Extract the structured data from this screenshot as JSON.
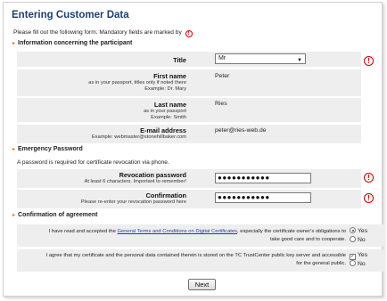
{
  "page": {
    "title": "Entering Customer Data",
    "intro": "Please fill out the following form. Mandatory fields are marked by",
    "required_icon": "!"
  },
  "sections": {
    "participant": "Information concerning the participant",
    "emergency": "Emergency Password",
    "confirmation": "Confirmation of agreement"
  },
  "participant": {
    "title_label": "Title",
    "title_value": "Mr",
    "first_name_label": "First name",
    "first_name_sub1": "as in your passport, titles only if noted there",
    "first_name_sub2": "Example: Dr. Mary",
    "first_name_value": "Peter",
    "last_name_label": "Last name",
    "last_name_sub1": "as in your passport",
    "last_name_sub2": "Example: Smith",
    "last_name_value": "Ries",
    "email_label": "E-mail address",
    "email_sub": "Example: webmaster@stonehillbaker.com",
    "email_value": "peter@ries-web.de"
  },
  "emergency": {
    "note": "A password is required for certificate revocation via phone.",
    "revocation_label": "Revocation password",
    "revocation_sub": "At least 6 characters. Important to remember!",
    "revocation_value": "●●●●●●●●●●●",
    "confirmation_label": "Confirmation",
    "confirmation_sub": "Please re-enter your revocation password here",
    "confirmation_value": "●●●●●●●●●●●"
  },
  "agreement": {
    "row1_pre": "I have read and accepted the",
    "row1_link": "General Terms and Conditions on Digital Certificates",
    "row1_post": ", especially the certificate owner's obligations to take good care and to cooperate.",
    "row2_text": "I agree that my certificate and the personal data contained therein is stored on the TC TrustCenter public key server and accessible for the general public.",
    "yes": "Yes",
    "no": "No"
  },
  "buttons": {
    "next": "Next"
  }
}
